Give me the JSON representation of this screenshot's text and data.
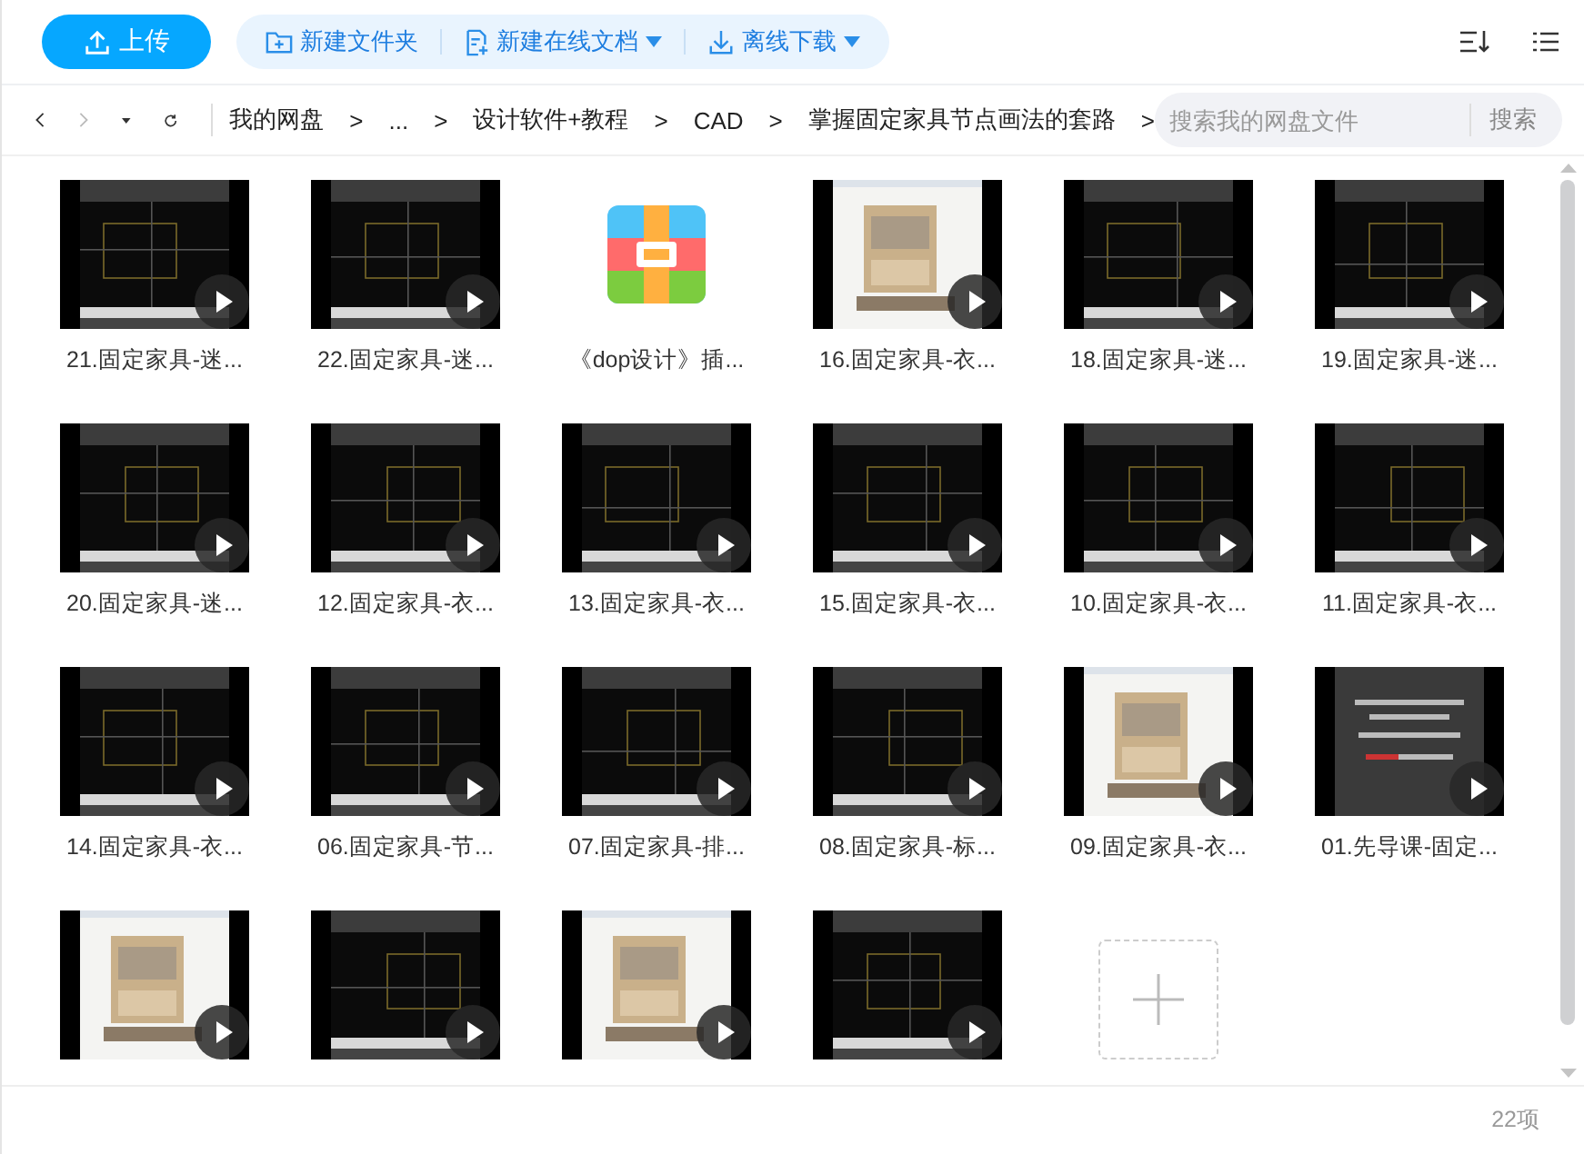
{
  "toolbar": {
    "upload_button": "上传",
    "actions": [
      {
        "label": "新建文件夹",
        "dropdown": false
      },
      {
        "label": "新建在线文档",
        "dropdown": true
      },
      {
        "label": "离线下载",
        "dropdown": true
      }
    ]
  },
  "nav": {
    "back_disabled": false,
    "forward_disabled": true
  },
  "breadcrumb": {
    "separator": ">",
    "items": [
      "我的网盘",
      "...",
      "设计软件+教程",
      "CAD",
      "掌握固定家具节点画法的套路"
    ]
  },
  "search": {
    "placeholder": "搜索我的网盘文件",
    "button": "搜索"
  },
  "files": [
    {
      "kind": "video",
      "name": "21.固定家具-迷..."
    },
    {
      "kind": "video",
      "name": "22.固定家具-迷..."
    },
    {
      "kind": "archive",
      "name": "《dop设计》插..."
    },
    {
      "kind": "video",
      "name": "16.固定家具-衣..."
    },
    {
      "kind": "video",
      "name": "18.固定家具-迷..."
    },
    {
      "kind": "video",
      "name": "19.固定家具-迷..."
    },
    {
      "kind": "video",
      "name": "20.固定家具-迷..."
    },
    {
      "kind": "video",
      "name": "12.固定家具-衣..."
    },
    {
      "kind": "video",
      "name": "13.固定家具-衣..."
    },
    {
      "kind": "video",
      "name": "15.固定家具-衣..."
    },
    {
      "kind": "video",
      "name": "10.固定家具-衣..."
    },
    {
      "kind": "video",
      "name": "11.固定家具-衣..."
    },
    {
      "kind": "video",
      "name": "14.固定家具-衣..."
    },
    {
      "kind": "video",
      "name": "06.固定家具-节..."
    },
    {
      "kind": "video",
      "name": "07.固定家具-排..."
    },
    {
      "kind": "video",
      "name": "08.固定家具-标..."
    },
    {
      "kind": "video",
      "name": "09.固定家具-衣..."
    },
    {
      "kind": "video",
      "name": "01.先导课-固定..."
    },
    {
      "kind": "video"
    },
    {
      "kind": "video"
    },
    {
      "kind": "video"
    },
    {
      "kind": "video"
    },
    {
      "kind": "upload"
    }
  ],
  "status_bar": {
    "count": "22项"
  }
}
